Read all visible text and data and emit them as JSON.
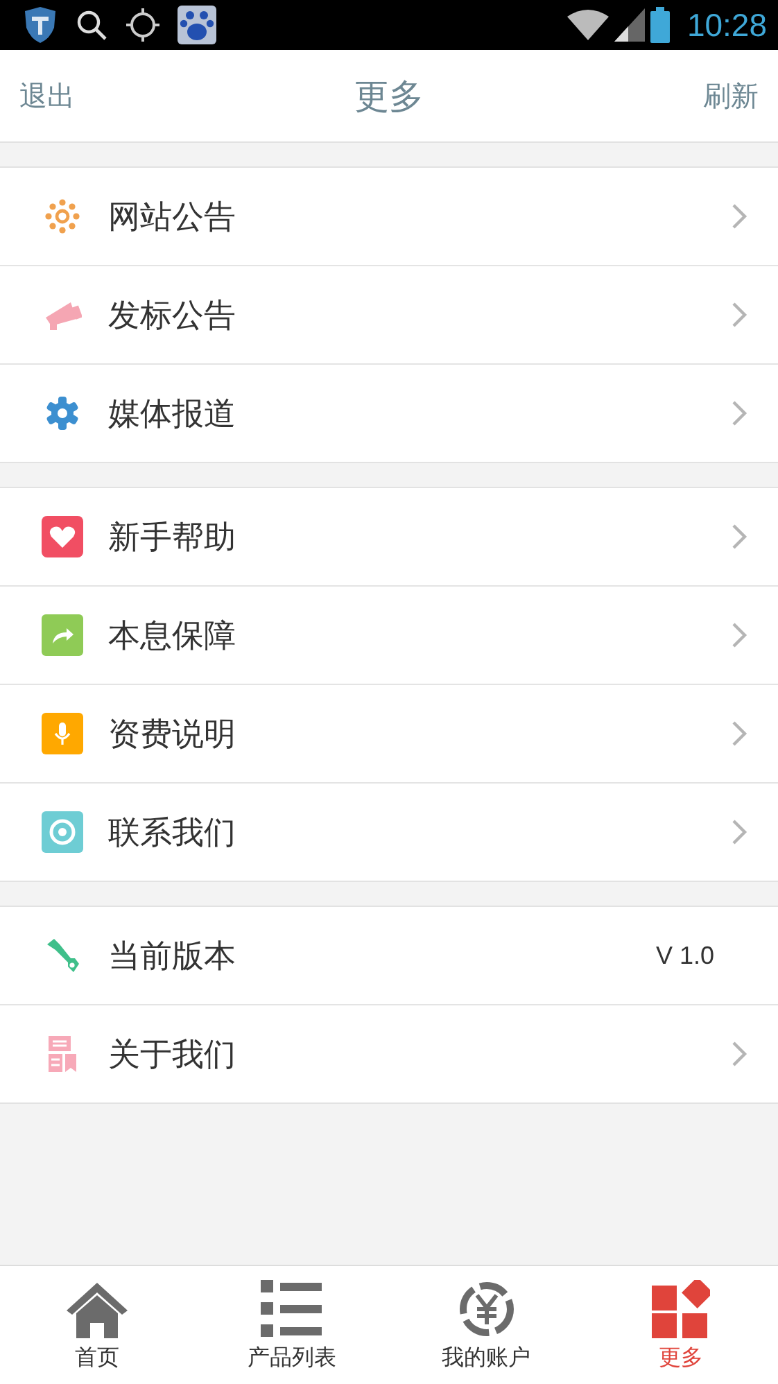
{
  "status_bar": {
    "time": "10:28"
  },
  "header": {
    "left": "退出",
    "title": "更多",
    "right": "刷新"
  },
  "sections": [
    {
      "items": [
        {
          "label": "网站公告"
        },
        {
          "label": "发标公告"
        },
        {
          "label": "媒体报道"
        }
      ]
    },
    {
      "items": [
        {
          "label": "新手帮助"
        },
        {
          "label": "本息保障"
        },
        {
          "label": "资费说明"
        },
        {
          "label": "联系我们"
        }
      ]
    },
    {
      "items": [
        {
          "label": "当前版本",
          "value": "V 1.0"
        },
        {
          "label": "关于我们"
        }
      ]
    }
  ],
  "tabs": [
    {
      "label": "首页",
      "selected": false
    },
    {
      "label": "产品列表",
      "selected": false
    },
    {
      "label": "我的账户",
      "selected": false
    },
    {
      "label": "更多",
      "selected": true
    }
  ]
}
